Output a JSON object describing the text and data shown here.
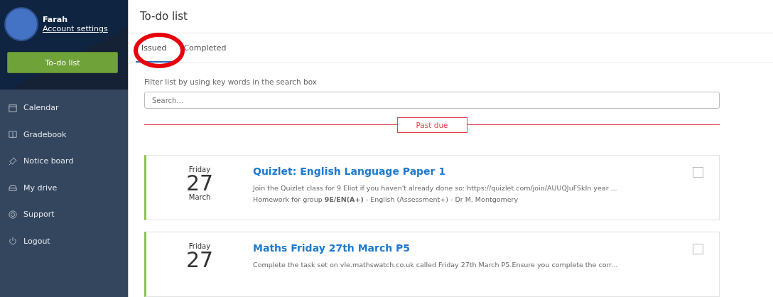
{
  "user": {
    "name": "Farah",
    "account_link": "Account settings"
  },
  "sidebar": {
    "primary_button": "To-do list",
    "items": [
      {
        "label": "Calendar",
        "kind": "calendar"
      },
      {
        "label": "Gradebook",
        "kind": "book"
      },
      {
        "label": "Notice board",
        "kind": "pin"
      },
      {
        "label": "My drive",
        "kind": "drive"
      },
      {
        "label": "Support",
        "kind": "lifebuoy"
      },
      {
        "label": "Logout",
        "kind": "power"
      }
    ]
  },
  "page": {
    "title": "To-do list"
  },
  "tabs": [
    {
      "label": "Issued",
      "selected": true
    },
    {
      "label": "Completed",
      "selected": false
    }
  ],
  "filter": {
    "hint": "Filter list by using key words in the search box",
    "placeholder": "Search..."
  },
  "section_label": "Past due",
  "tasks": [
    {
      "weekday": "Friday",
      "day": "27",
      "month": "March",
      "title": "Quizlet: English Language Paper 1",
      "description": "Join the Quizlet class for 9 Eliot if you haven't already done so: https://quizlet.com/join/AUUQJuFSkIn year ...",
      "meta": "Homework for group **9E/EN(A+)** - English (Assessment+) - Dr M. Montgomery",
      "checked": false
    },
    {
      "weekday": "Friday",
      "day": "27",
      "title": "Maths Friday 27th March P5",
      "description": "Complete the task set on vle.mathswatch.co.uk called Friday 27th March P5.Ensure you complete the corr...",
      "checked": false
    }
  ]
}
